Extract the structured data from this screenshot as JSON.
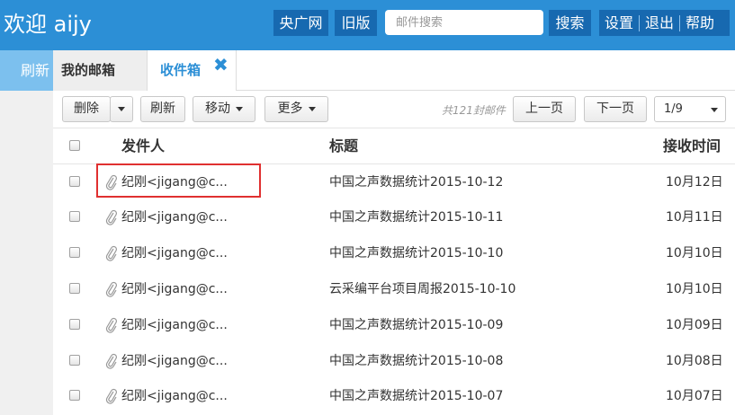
{
  "header": {
    "welcome": "欢迎 aijy",
    "cnr_label": "央广网",
    "old_version_label": "旧版",
    "search_placeholder": "邮件搜索",
    "search_button": "搜索",
    "settings": "设置",
    "logout": "退出",
    "help": "帮助"
  },
  "sidebar": {
    "refresh": "刷新"
  },
  "tabs": [
    {
      "label": "我的邮箱"
    },
    {
      "label": "收件箱",
      "active": true
    }
  ],
  "toolbar": {
    "delete": "删除",
    "refresh": "刷新",
    "move": "移动",
    "more": "更多",
    "count_text": "共121封邮件",
    "prev_page": "上一页",
    "next_page": "下一页",
    "page_value": "1/9"
  },
  "table": {
    "columns": [
      "发件人",
      "标题",
      "接收时间"
    ],
    "rows": [
      {
        "sender": "纪刚<jigang@c...",
        "subject": "中国之声数据统计2015-10-12",
        "date": "10月12日"
      },
      {
        "sender": "纪刚<jigang@c...",
        "subject": "中国之声数据统计2015-10-11",
        "date": "10月11日"
      },
      {
        "sender": "纪刚<jigang@c...",
        "subject": "中国之声数据统计2015-10-10",
        "date": "10月10日"
      },
      {
        "sender": "纪刚<jigang@c...",
        "subject": "云采编平台项目周报2015-10-10",
        "date": "10月10日"
      },
      {
        "sender": "纪刚<jigang@c...",
        "subject": "中国之声数据统计2015-10-09",
        "date": "10月09日"
      },
      {
        "sender": "纪刚<jigang@c...",
        "subject": "中国之声数据统计2015-10-08",
        "date": "10月08日"
      },
      {
        "sender": "纪刚<jigang@c...",
        "subject": "中国之声数据统计2015-10-07",
        "date": "10月07日"
      }
    ]
  },
  "colors": {
    "header_bg": "#2c8fd6",
    "header_button_bg": "#1769b0",
    "accent": "#2c8fd6",
    "highlight_border": "#e03030"
  }
}
